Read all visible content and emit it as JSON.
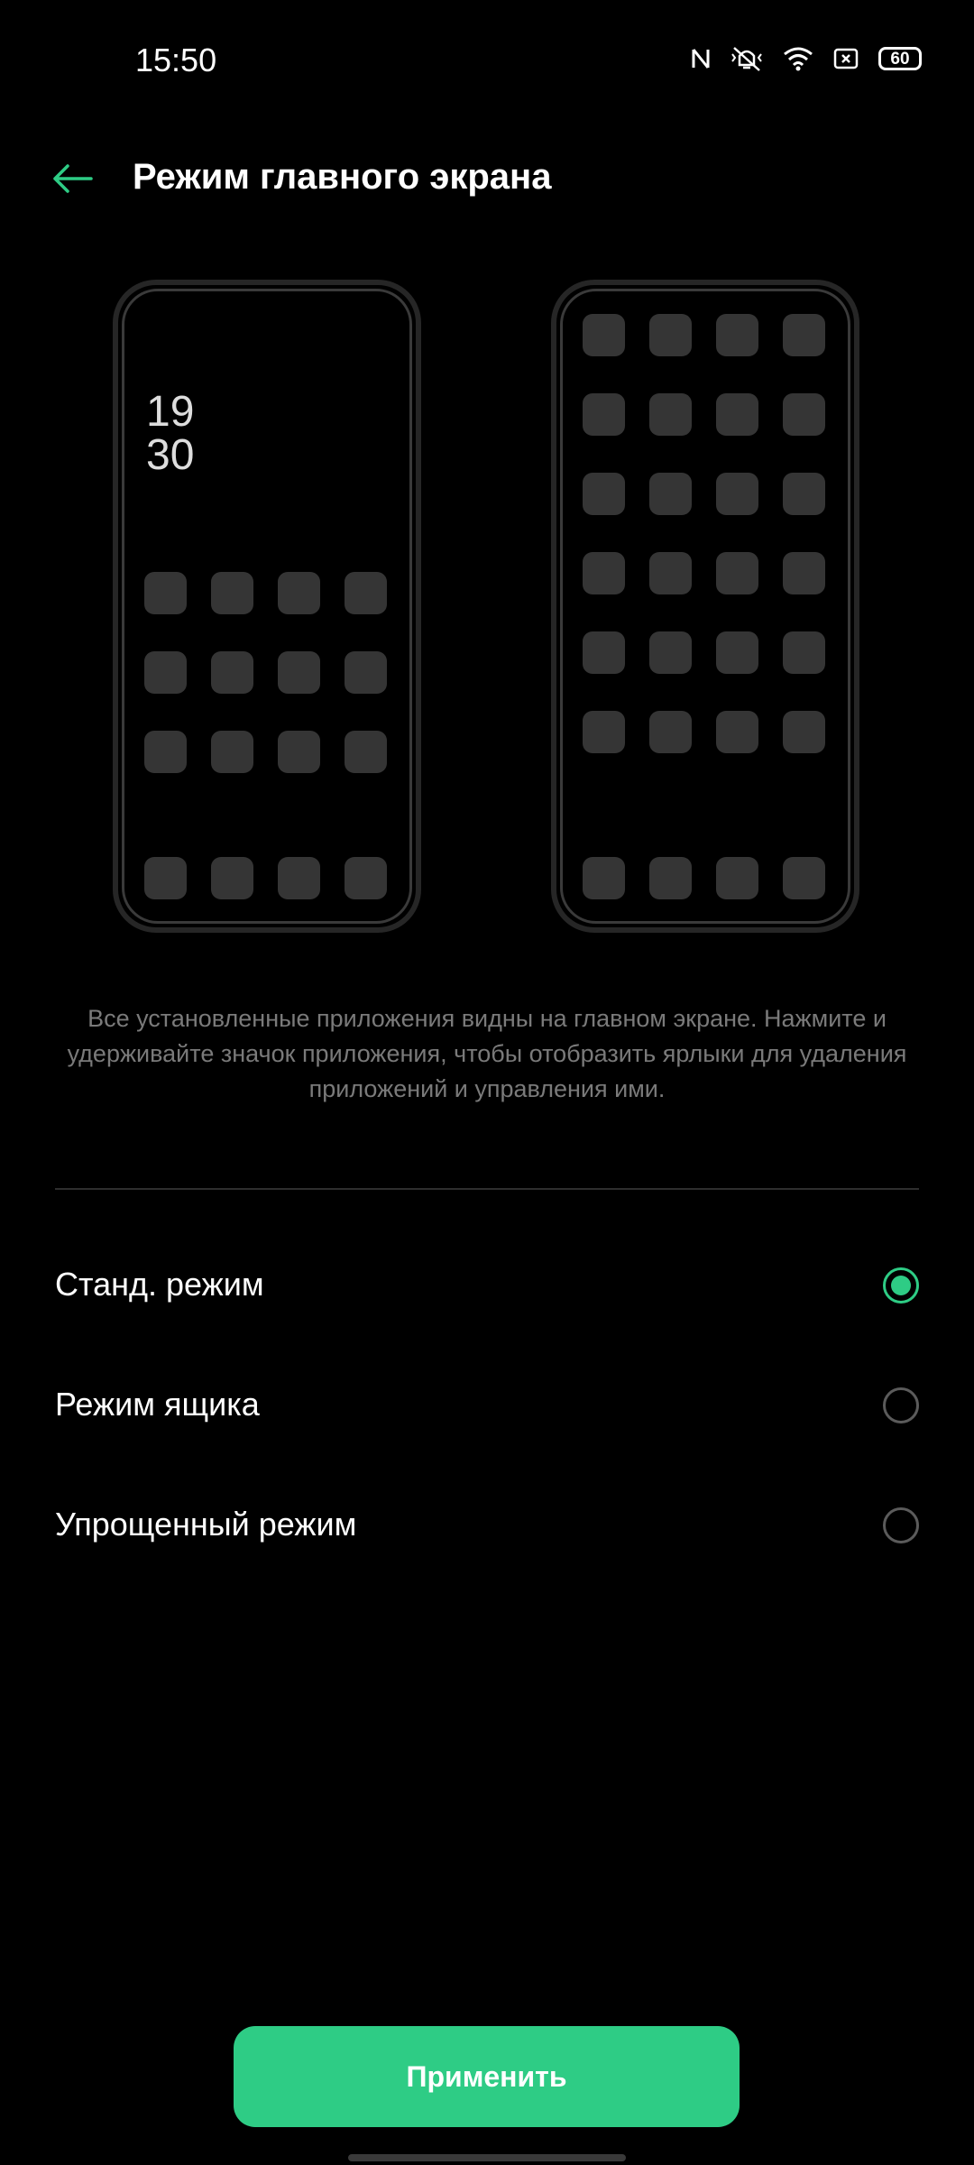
{
  "status_bar": {
    "time": "15:50",
    "battery_level": "60",
    "icons": [
      "nfc-icon",
      "vibrate-off-icon",
      "wifi-icon",
      "sim-icon",
      "battery-icon"
    ]
  },
  "header": {
    "title": "Режим главного экрана",
    "back_icon": "arrow-left-icon"
  },
  "previews": {
    "left_clock_hour": "19",
    "left_clock_minute": "30"
  },
  "description": "Все установленные приложения видны на главном экране. Нажмите и удерживайте значок приложения, чтобы отобразить ярлыки для удаления приложений и управления ими.",
  "options": [
    {
      "label": "Станд. режим",
      "selected": true
    },
    {
      "label": "Режим ящика",
      "selected": false
    },
    {
      "label": "Упрощенный режим",
      "selected": false
    }
  ],
  "apply_button": {
    "label": "Применить"
  },
  "colors": {
    "accent": "#2ecc85",
    "background": "#000000",
    "description_text": "#7a7a7a"
  }
}
